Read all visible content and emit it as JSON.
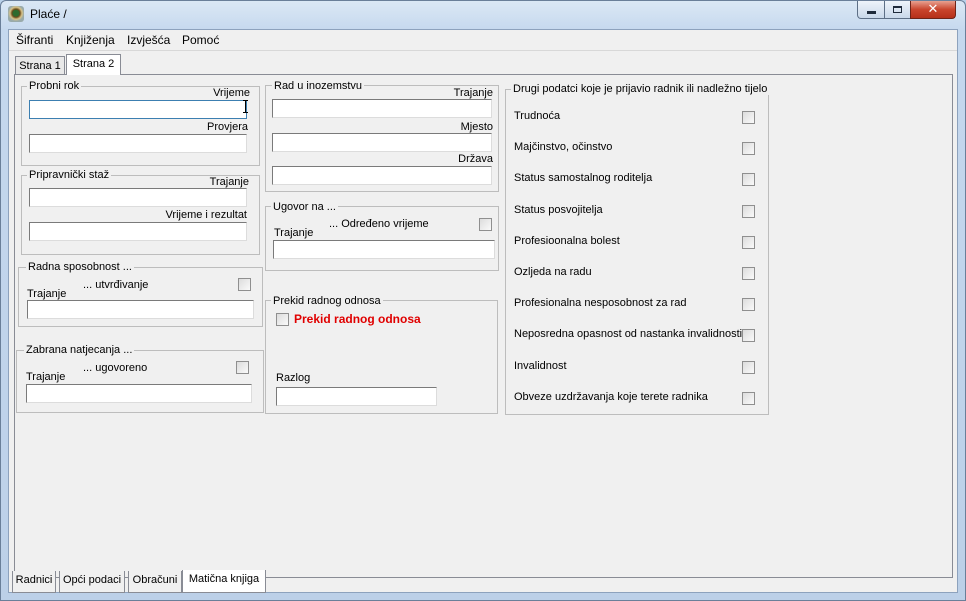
{
  "window": {
    "title": "Plaće /"
  },
  "menu": [
    "Šifranti",
    "Knjiženja",
    "Izvješća",
    "Pomoć"
  ],
  "top_tabs": [
    {
      "label": "Strana 1",
      "active": false
    },
    {
      "label": "Strana 2",
      "active": true
    }
  ],
  "probni_rok": {
    "legend": "Probni rok",
    "vrijeme_label": "Vrijeme",
    "vrijeme_value": "",
    "provjera_label": "Provjera",
    "provjera_value": ""
  },
  "pripravnicki": {
    "legend": "Pripravnički staž",
    "trajanje_label": "Trajanje",
    "trajanje_value": "",
    "vrijeme_rez_label": "Vrijeme i rezultat",
    "vrijeme_rez_value": ""
  },
  "radna_sposobnost": {
    "legend": "Radna sposobnost ...",
    "check_label": "... utvrđivanje",
    "checked": false,
    "trajanje_label": "Trajanje",
    "trajanje_value": ""
  },
  "zabrana": {
    "legend": "Zabrana natjecanja ...",
    "check_label": "... ugovoreno",
    "checked": false,
    "trajanje_label": "Trajanje",
    "trajanje_value": ""
  },
  "inozemstvo": {
    "legend": "Rad u inozemstvu",
    "trajanje_label": "Trajanje",
    "trajanje_value": "",
    "mjesto_label": "Mjesto",
    "mjesto_value": "",
    "drzava_label": "Država",
    "drzava_value": ""
  },
  "ugovor": {
    "legend": "Ugovor na ...",
    "check_label": "... Određeno vrijeme",
    "checked": false,
    "trajanje_label": "Trajanje",
    "trajanje_value": ""
  },
  "prekid": {
    "legend": "Prekid radnog odnosa",
    "check_label": "Prekid radnog odnosa",
    "checked": false,
    "razlog_label": "Razlog",
    "razlog_value": ""
  },
  "drugi": {
    "legend": "Drugi podatci koje je prijavio radnik ili nadležno tijelo",
    "items": [
      {
        "label": "Trudnoća",
        "checked": false
      },
      {
        "label": "Majčinstvo, očinstvo",
        "checked": false
      },
      {
        "label": "Status samostalnog roditelja",
        "checked": false
      },
      {
        "label": "Status posvojitelja",
        "checked": false
      },
      {
        "label": "Profesioonalna bolest",
        "checked": false
      },
      {
        "label": "Ozljeda na radu",
        "checked": false
      },
      {
        "label": "Profesionalna nesposobnost za rad",
        "checked": false
      },
      {
        "label": "Neposredna opasnost od nastanka invalidnosti",
        "checked": false
      },
      {
        "label": "Invalidnost",
        "checked": false
      },
      {
        "label": "Obveze uzdržavanja koje terete radnika",
        "checked": false
      }
    ]
  },
  "bottom_tabs": [
    {
      "label": "Radnici",
      "active": false
    },
    {
      "label": "Opći podaci",
      "active": false
    },
    {
      "label": "Obračuni",
      "active": false
    },
    {
      "label": "Matična knjiga",
      "active": true
    }
  ]
}
